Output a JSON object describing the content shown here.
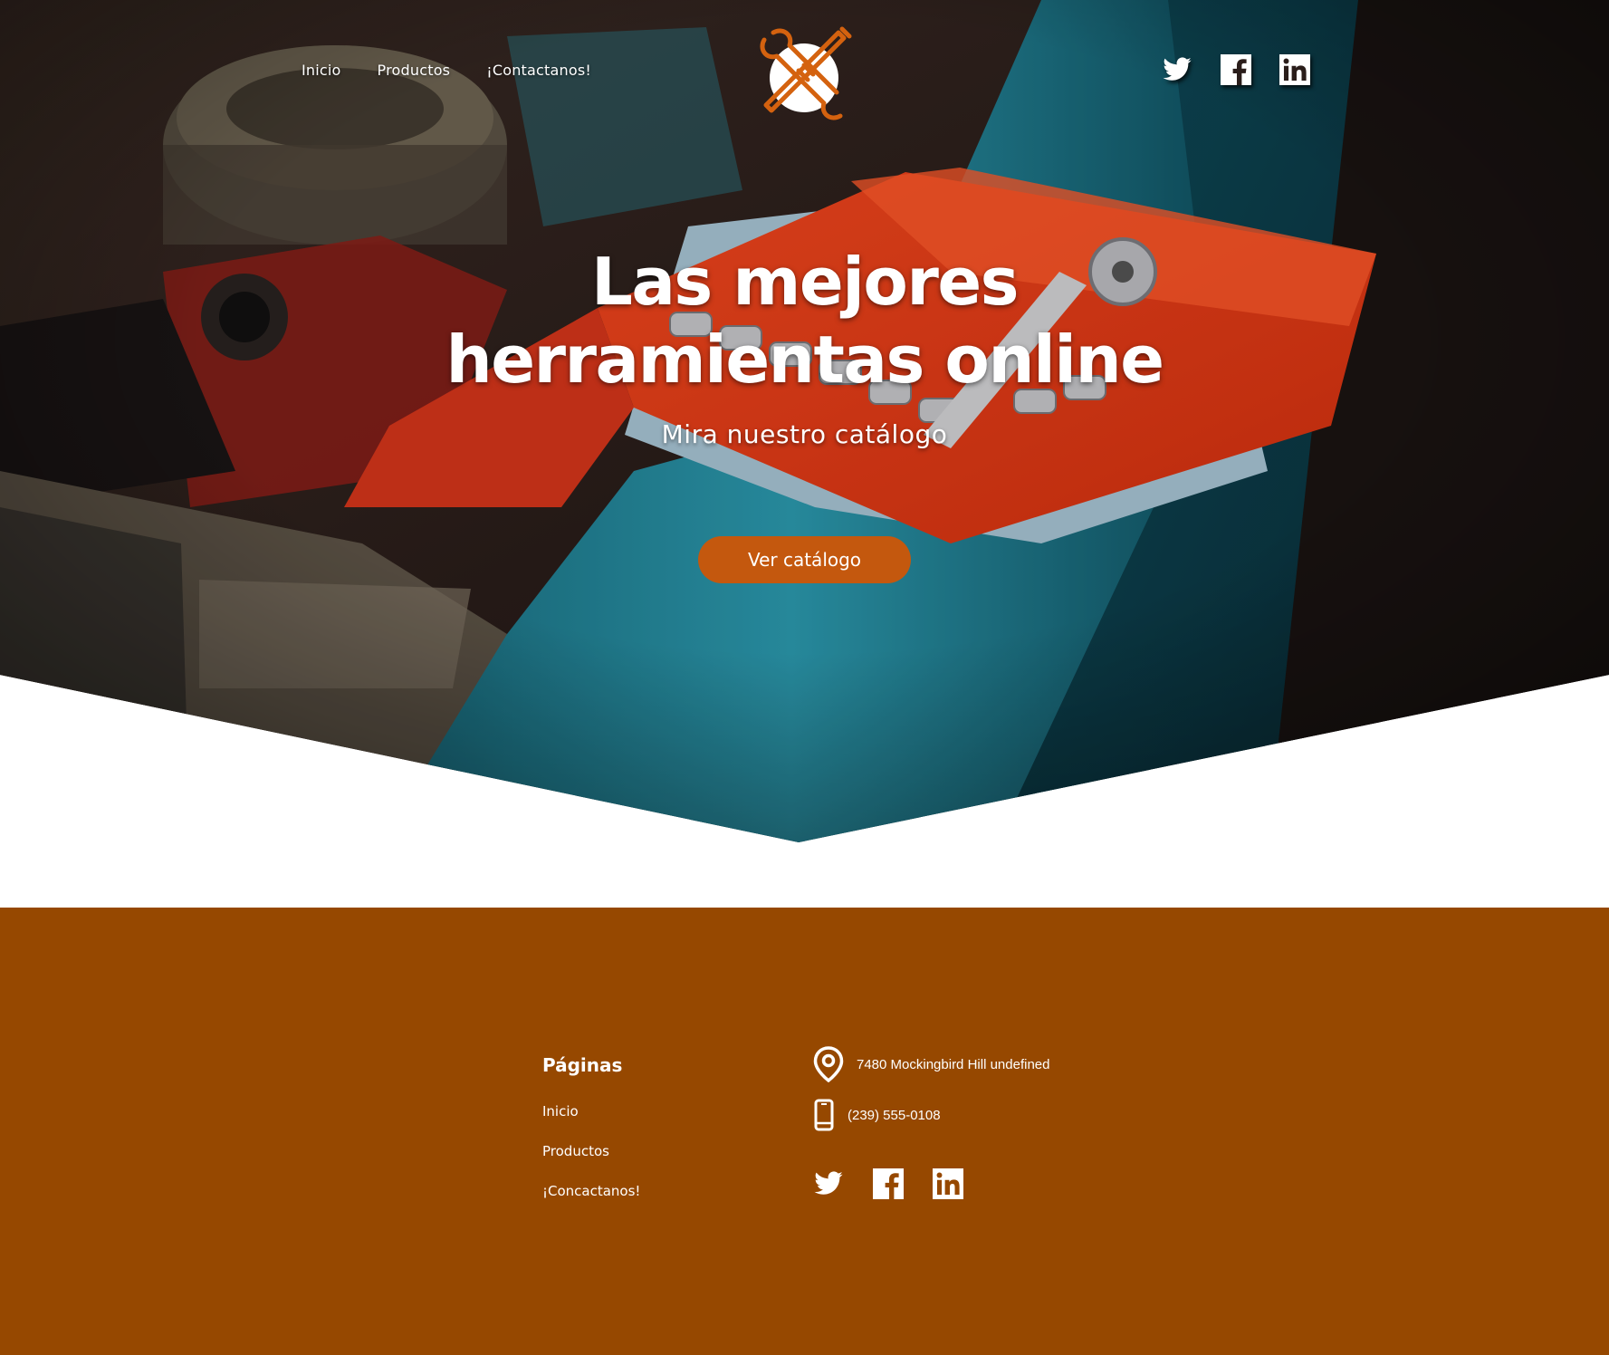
{
  "nav": {
    "links": [
      {
        "label": "Inicio"
      },
      {
        "label": "Productos"
      },
      {
        "label": "¡Contactanos!"
      }
    ]
  },
  "logo": {
    "icon": "wrench-screwdriver-logo-icon",
    "accent": "#d4620f"
  },
  "social_top": [
    "twitter-icon",
    "facebook-icon",
    "linkedin-icon"
  ],
  "hero": {
    "headline_line1": "Las mejores",
    "headline_line2": "herramientas online",
    "subtitle": "Mira nuestro catálogo",
    "cta_label": "Ver catálogo",
    "cta_color": "#c4580e"
  },
  "footer": {
    "background": "#964800",
    "pages_title": "Páginas",
    "pages_links": [
      "Inicio",
      "Productos",
      "¡Concactanos!"
    ],
    "address": "7480 Mockingbird Hill undefined",
    "phone": "(239) 555-0108",
    "social": [
      "twitter-icon",
      "facebook-icon",
      "linkedin-icon"
    ]
  }
}
